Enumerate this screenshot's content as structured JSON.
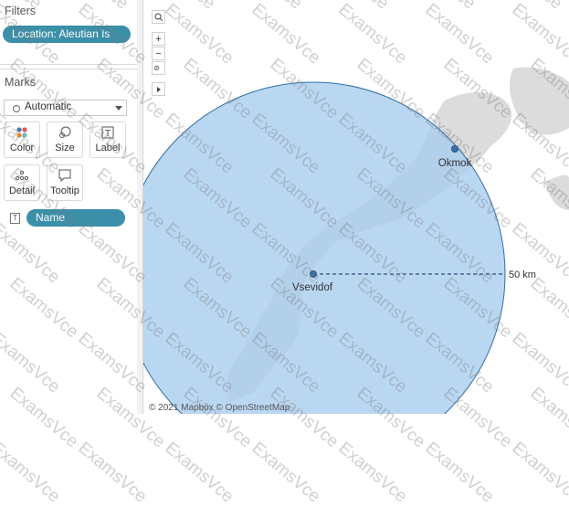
{
  "filters": {
    "title": "Filters",
    "pill": "Location: Aleutian Is"
  },
  "marks": {
    "title": "Marks",
    "mark_type": "Automatic",
    "buttons": [
      {
        "label": "Color",
        "icon": "color-dots-icon"
      },
      {
        "label": "Size",
        "icon": "size-icon"
      },
      {
        "label": "Label",
        "icon": "label-icon"
      },
      {
        "label": "Detail",
        "icon": "detail-icon"
      },
      {
        "label": "Tooltip",
        "icon": "tooltip-icon"
      }
    ],
    "field_pill": "Name",
    "field_icon": "T"
  },
  "map": {
    "points": [
      {
        "name": "Okmok"
      },
      {
        "name": "Vsevidof"
      }
    ],
    "radius_label": "50 km",
    "attribution": "© 2021 Mapbox © OpenStreetMap",
    "tools": [
      "search-icon",
      "zoom-in-icon",
      "zoom-out-icon",
      "reset-zoom-icon",
      "expand-arrow-icon"
    ],
    "circle_fill": "#a9cdef",
    "circle_stroke": "#2f6fa6"
  },
  "watermark": "ExamsVce"
}
